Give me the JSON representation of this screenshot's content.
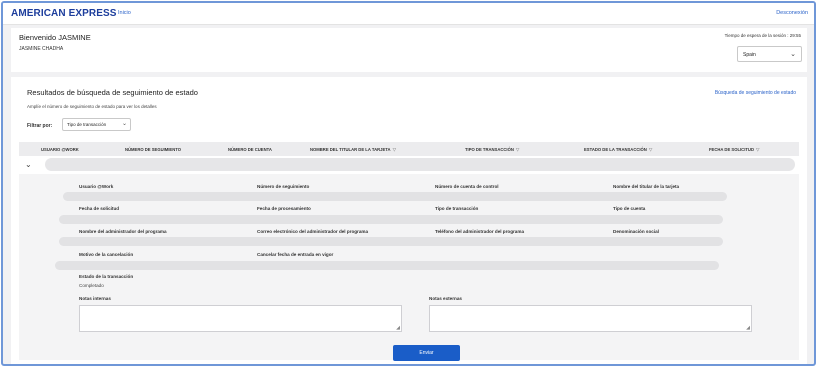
{
  "header": {
    "brand": "AMERICAN EXPRESS",
    "home_link": "Inicio",
    "logout_link": "Desconexión"
  },
  "welcome": {
    "title": "Bienvenido JASMINE",
    "user_name": "JASMINE CHADHA",
    "session_timeout": "Tiempo de espera de la sesión : 29:55",
    "language_value": "Spain"
  },
  "results": {
    "title": "Resultados de búsqueda de seguimiento de estado",
    "search_link": "Búsqueda de seguimiento de estado",
    "subtitle": "Amplíe el número de seguimiento de estado para ver los detalles",
    "filter_label": "Filtrar por:",
    "filter_value": "Tipo de transacción",
    "columns": [
      "Usuario @Work",
      "Número de seguimiento",
      "Número de cuenta",
      "Nombre del titular de la tarjeta",
      "Tipo de transacción",
      "Estado de la transacción",
      "Fecha de solicitud"
    ]
  },
  "details": {
    "row1": [
      "Usuario @Work",
      "Número de seguimiento",
      "Número de cuenta de control",
      "Nombre del titular de la tarjeta"
    ],
    "row2": [
      "Fecha de solicitud",
      "Fecha de procesamiento",
      "Tipo de transacción",
      "Tipo de cuenta"
    ],
    "row3": [
      "Nombre del administrador del programa",
      "Correo electrónico del administrador del programa",
      "Teléfono del administrador del programa",
      "Denominación social"
    ],
    "row4": [
      "Motivo de la cancelación",
      "Cancelar fecha de entrada en vigor"
    ],
    "status_label": "Estado de la transacción",
    "status_value": "Completado",
    "internal_notes_label": "Notas internas",
    "external_notes_label": "Notas externas",
    "submit_label": "Enviar"
  },
  "colors": {
    "brand": "#1c3d9c",
    "link": "#2a62c9",
    "primary_button": "#1a5dc8",
    "frame_border": "#6f97d8"
  }
}
